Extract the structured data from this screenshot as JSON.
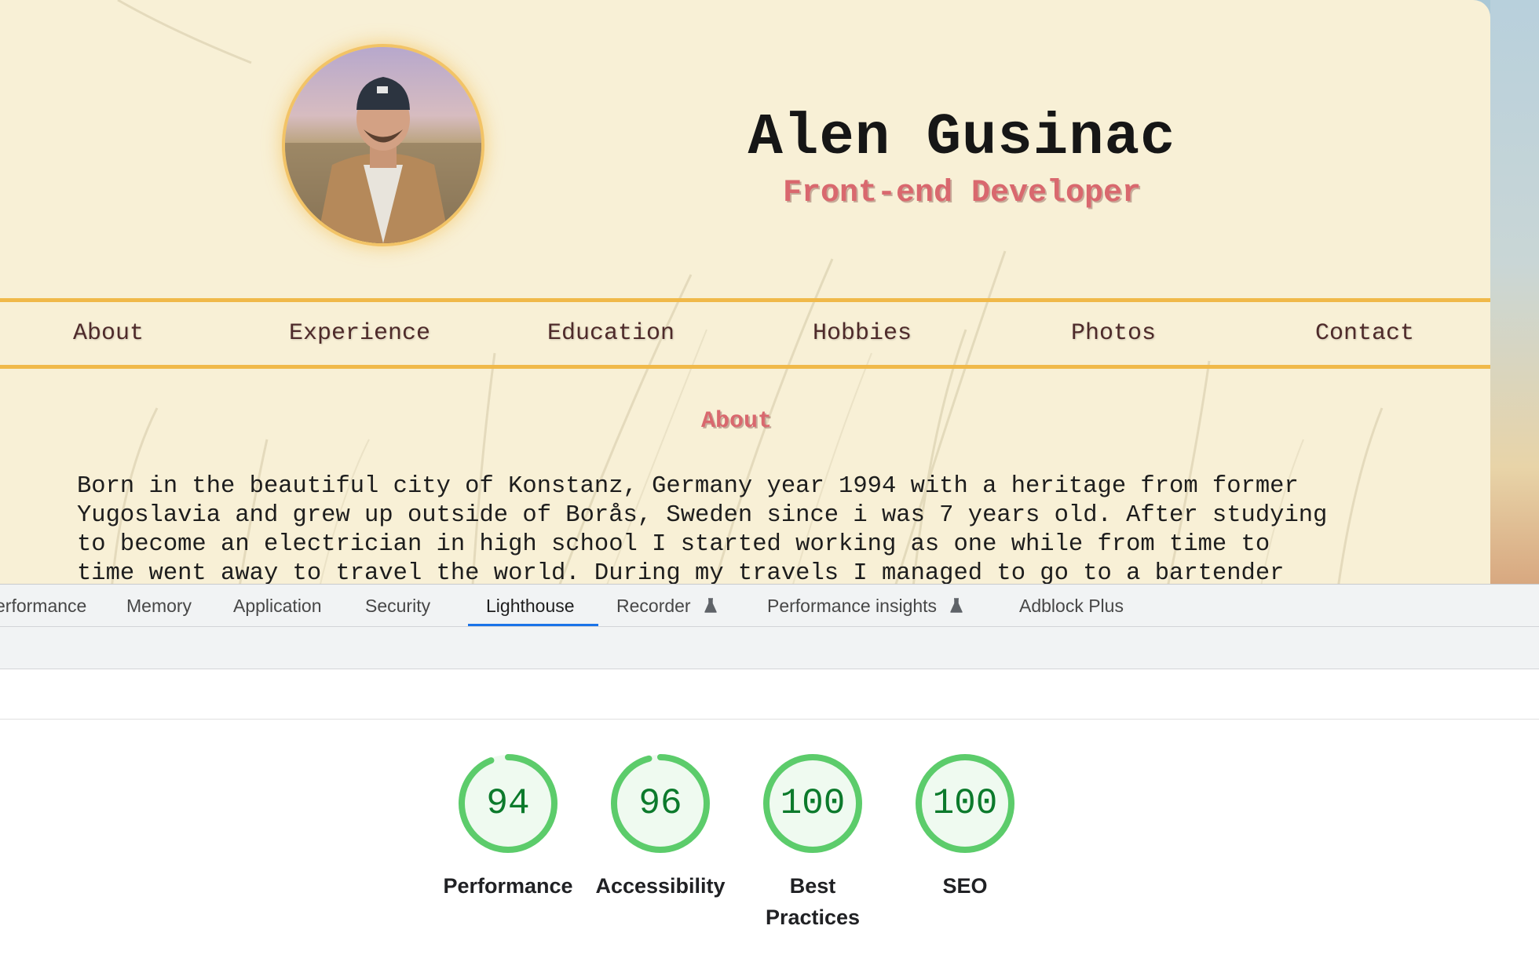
{
  "site": {
    "name": "Alen Gusinac",
    "role": "Front-end Developer",
    "nav": [
      "About",
      "Experience",
      "Education",
      "Hobbies",
      "Photos",
      "Contact"
    ],
    "about_heading": "About",
    "about_text": "Born in the beautiful city of Konstanz, Germany year 1994 with a heritage from former\nYugoslavia and grew up outside of Borås, Sweden since i was 7 years old. After studying\nto become an electrician in high school I started working as one while from time to\ntime went away to travel the world. During my travels I managed to go to a bartender"
  },
  "devtools": {
    "tabs": [
      {
        "label": "erformance"
      },
      {
        "label": "Memory"
      },
      {
        "label": "Application"
      },
      {
        "label": "Security"
      },
      {
        "label": "Lighthouse",
        "active": true
      },
      {
        "label": "Recorder",
        "icon": "flask-icon"
      },
      {
        "label": "Performance insights",
        "icon": "flask-icon"
      },
      {
        "label": "Adblock Plus"
      }
    ],
    "scores": [
      {
        "value": "94",
        "label": "Performance",
        "fraction": 0.94
      },
      {
        "value": "96",
        "label": "Accessibility",
        "fraction": 0.96
      },
      {
        "value": "100",
        "label": "Best Practices",
        "fraction": 1.0
      },
      {
        "value": "100",
        "label": "SEO",
        "fraction": 1.0
      }
    ],
    "colors": {
      "gauge_ring": "#5ccc6b",
      "gauge_fill": "#effaf0",
      "gauge_text": "#0c7a2c",
      "active_tab": "#1a73e8"
    }
  },
  "theme": {
    "accent_border": "#f0b94a",
    "subtitle_color": "#d9686e",
    "card_bg": "#f8f0d6"
  }
}
